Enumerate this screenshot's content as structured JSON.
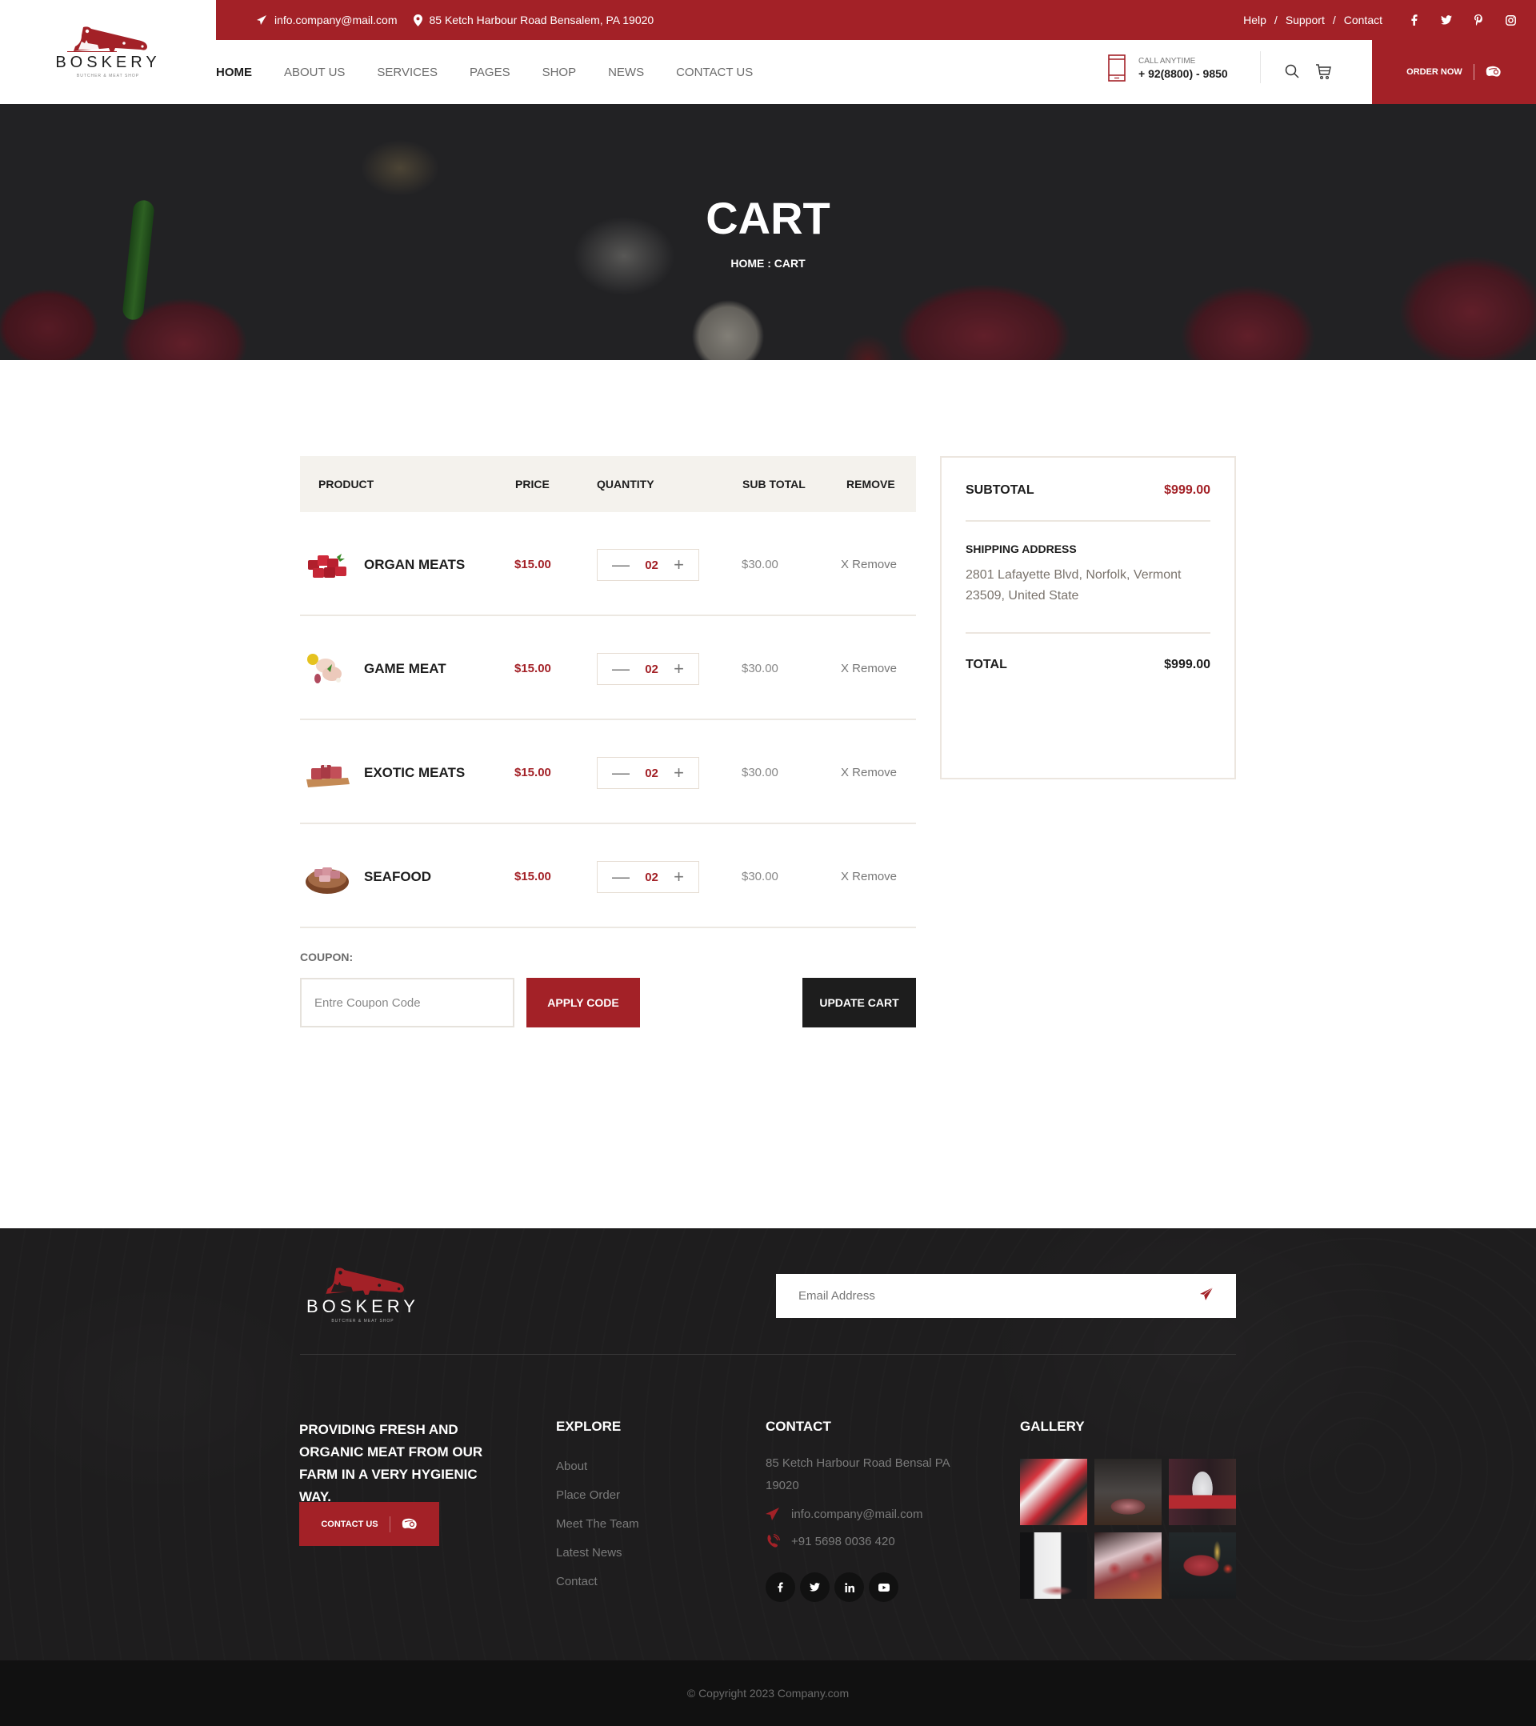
{
  "brand": {
    "name": "BOSKERY",
    "tagline": "BUTCHER & MEAT SHOP",
    "accent_color": "#a32127",
    "dark_color": "#1d1d1d"
  },
  "topbar": {
    "email": "info.company@mail.com",
    "address": "85 Ketch Harbour Road Bensalem, PA 19020",
    "links": [
      "Help",
      "Support",
      "Contact"
    ],
    "separator": "/",
    "social_icons": [
      "facebook-icon",
      "twitter-icon",
      "pinterest-icon",
      "instagram-icon"
    ]
  },
  "nav": {
    "items": [
      {
        "label": "HOME",
        "active": true
      },
      {
        "label": "ABOUT US",
        "active": false
      },
      {
        "label": "SERVICES",
        "active": false
      },
      {
        "label": "PAGES",
        "active": false
      },
      {
        "label": "SHOP",
        "active": false
      },
      {
        "label": "NEWS",
        "active": false
      },
      {
        "label": "CONTACT US",
        "active": false
      }
    ],
    "call_label": "CALL ANYTIME",
    "call_number": "+ 92(8800) - 9850",
    "order_label": "ORDER NOW"
  },
  "hero": {
    "title": "CART",
    "breadcrumb": "HOME : CART"
  },
  "cart": {
    "columns": [
      "PRODUCT",
      "PRICE",
      "QUANTITY",
      "SUB TOTAL",
      "REMOVE"
    ],
    "items": [
      {
        "name": "ORGAN MEATS",
        "price": "$15.00",
        "quantity": "02",
        "subtotal": "$30.00",
        "remove": "X Remove"
      },
      {
        "name": "GAME MEAT",
        "price": "$15.00",
        "quantity": "02",
        "subtotal": "$30.00",
        "remove": "X Remove"
      },
      {
        "name": "EXOTIC MEATS",
        "price": "$15.00",
        "quantity": "02",
        "subtotal": "$30.00",
        "remove": "X Remove"
      },
      {
        "name": "SEAFOOD",
        "price": "$15.00",
        "quantity": "02",
        "subtotal": "$30.00",
        "remove": "X Remove"
      }
    ],
    "coupon_label": "COUPON:",
    "coupon_placeholder": "Entre Coupon Code",
    "coupon_value": "",
    "apply_label": "APPLY CODE",
    "update_label": "UPDATE CART"
  },
  "summary": {
    "subtotal_label": "SUBTOTAL",
    "subtotal_value": "$999.00",
    "shipping_label": "SHIPPING ADDRESS",
    "shipping_address": "2801 Lafayette Blvd, Norfolk, Vermont 23509, United State",
    "total_label": "TOTAL",
    "total_value": "$999.00"
  },
  "footer": {
    "newsletter_placeholder": "Email Address",
    "tagline": "PROVIDING FRESH AND ORGANIC MEAT FROM OUR FARM IN A VERY HYGIENIC WAY.",
    "contact_button": "CONTACT US",
    "explore": {
      "heading": "EXPLORE",
      "links": [
        "About",
        "Place Order",
        "Meet The Team",
        "Latest News",
        "Contact"
      ]
    },
    "contact": {
      "heading": "CONTACT",
      "address": "85 Ketch Harbour Road Bensal PA 19020",
      "email": "info.company@mail.com",
      "phone": "+91 5698 0036 420",
      "social_icons": [
        "facebook-icon",
        "twitter-icon",
        "linkedin-icon",
        "youtube-icon"
      ]
    },
    "gallery": {
      "heading": "GALLERY",
      "images": [
        "packaged-meat-trays",
        "butcher-cleaver-cutting",
        "butcher-holding-crate",
        "butcher-knife-cutting",
        "raw-steaks-gloved-hands",
        "diced-meat-with-oil"
      ]
    },
    "copyright": "© Copyright 2023 Company.com"
  }
}
